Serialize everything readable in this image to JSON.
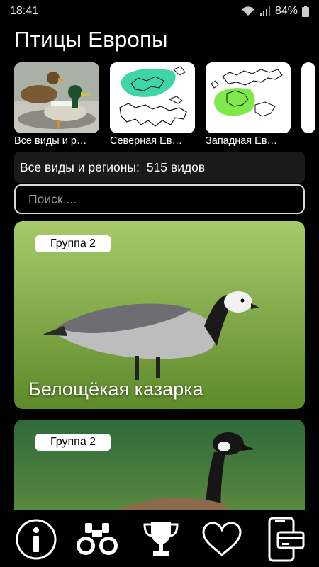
{
  "status": {
    "time": "18:41",
    "battery": "84%"
  },
  "app": {
    "title": "Птицы Европы"
  },
  "regions": [
    {
      "label": "Все виды и р…",
      "icon": "ducks-photo"
    },
    {
      "label": "Северная Ев…",
      "icon": "europe-map-north"
    },
    {
      "label": "Западная Ев…",
      "icon": "europe-map-west"
    }
  ],
  "summary": {
    "label": "Все виды и регионы:",
    "count": "515 видов"
  },
  "search": {
    "placeholder": "Поиск ..."
  },
  "cards": [
    {
      "group": "Группа 2",
      "name": "Белощёкая казарка"
    },
    {
      "group": "Группа 2"
    }
  ],
  "nav": [
    "info-icon",
    "binoculars-icon",
    "trophy-icon",
    "heart-icon",
    "phone-card-icon"
  ],
  "colors": {
    "map_north": "#3ed6a7",
    "map_west": "#7fe84a"
  }
}
